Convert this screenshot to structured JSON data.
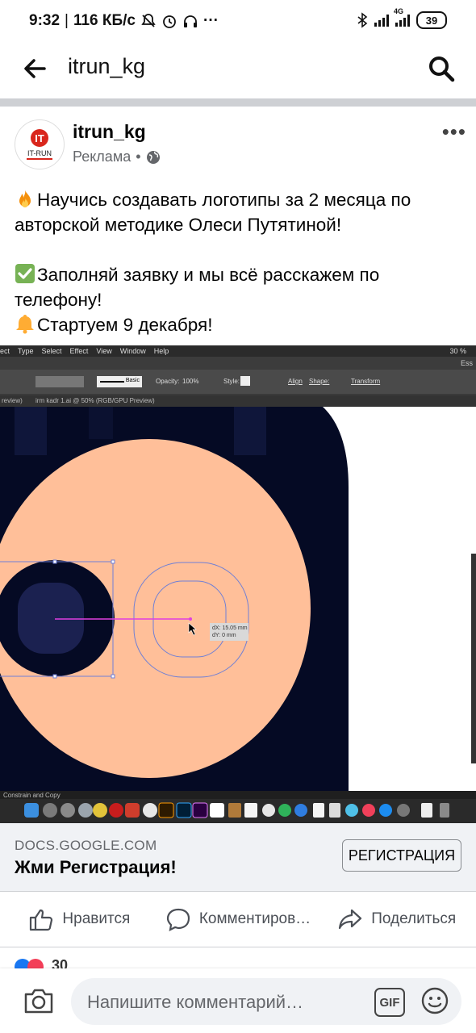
{
  "status_bar": {
    "time": "9:32",
    "network_speed": "116 КБ/с",
    "network_type": "4G",
    "battery": "39"
  },
  "app_bar": {
    "title": "itrun_kg",
    "back_icon": "arrow-left-icon",
    "search_icon": "search-icon"
  },
  "post": {
    "page_name": "itrun_kg",
    "sponsored_label": "Реклама",
    "audience_icon": "globe-icon",
    "avatar_text": "IT",
    "avatar_subtext": "IT-RUN",
    "lines": [
      "Научись создавать логотипы за 2 месяца  по авторской методике Олеси Путятиной!",
      "Заполняй заявку и мы всё расскажем по телефону!",
      "Стартуем 9 декабря!"
    ],
    "emojis": [
      "fire-icon",
      "check-mark-icon",
      "bell-icon"
    ]
  },
  "media": {
    "menu_items": [
      "ect",
      "Type",
      "Select",
      "Effect",
      "View",
      "Window",
      "Help"
    ],
    "battery_text": "30 %",
    "toolbar_items": [
      "Basic",
      "Opacity:",
      "100%",
      "Style:",
      "Align",
      "Shape:",
      "Transform"
    ],
    "doc_tab_1": "review)",
    "doc_tab_2": "irm kadr 1.ai @ 50% (RGB/GPU Preview)",
    "measure_dx": "dX: 15.05 mm",
    "measure_dy": "dY: 0 mm",
    "status_text": "Constrain and Copy",
    "right_label": "Ess"
  },
  "link": {
    "domain": "DOCS.GOOGLE.COM",
    "title": "Жми Регистрация!",
    "cta": "РЕГИСТРАЦИЯ"
  },
  "actions": {
    "like": "Нравится",
    "comment": "Комментиров…",
    "share": "Поделиться"
  },
  "reactions": {
    "count": "30"
  },
  "composer": {
    "placeholder": "Напишите комментарий…",
    "gif_label": "GIF"
  },
  "colors": {
    "skin": "#ffbf99",
    "navy": "#050a24",
    "navy_inner": "#1b2150",
    "facebook_text": "#050505",
    "secondary": "#65676b",
    "divider": "#ced0d4",
    "link_bg": "#f0f2f5"
  }
}
